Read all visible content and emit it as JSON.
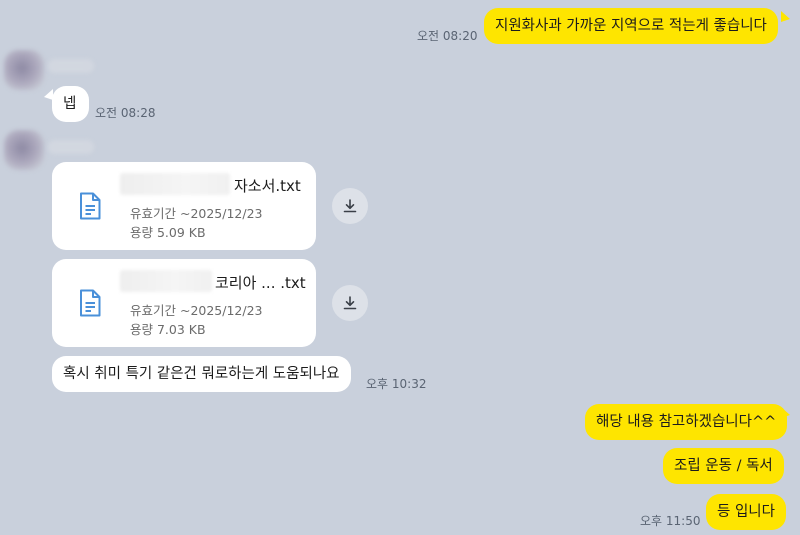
{
  "messages": {
    "m1": {
      "text": "지원화사과 가까운 지역으로 적는게 좋습니다",
      "time": "오전 08:20"
    },
    "m2": {
      "text": "넵",
      "time": "오전 08:28"
    },
    "file1": {
      "name_suffix": "자소서.txt",
      "validity": "유효기간 ~2025/12/23",
      "size": "용량 5.09 KB"
    },
    "file2": {
      "name_suffix": "코리아 ...  .txt",
      "validity": "유효기간 ~2025/12/23",
      "size": "용량 7.03 KB"
    },
    "m3": {
      "text": "혹시 취미 특기 같은건 뭐로하는게 도움되나요",
      "time": "오후 10:32"
    },
    "m4": {
      "text": "해당 내용 참고하겠습니다^^"
    },
    "m5": {
      "text": "조립 운동 / 독서"
    },
    "m6": {
      "text": "등 입니다",
      "time": "오후 11:50"
    }
  },
  "icons": {
    "file": "document-icon",
    "download": "download-icon"
  },
  "colors": {
    "background": "#c9d0dc",
    "my_bubble": "#fee500",
    "their_bubble": "#ffffff",
    "file_icon": "#4a90d9"
  }
}
